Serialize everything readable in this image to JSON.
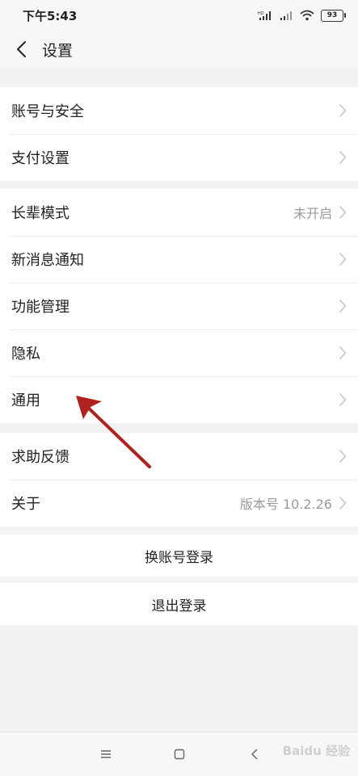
{
  "status_bar": {
    "time": "下午5:43",
    "battery": "93"
  },
  "header": {
    "title": "设置"
  },
  "groups": [
    {
      "items": [
        {
          "label": "账号与安全",
          "value": ""
        },
        {
          "label": "支付设置",
          "value": ""
        }
      ]
    },
    {
      "items": [
        {
          "label": "长辈模式",
          "value": "未开启"
        },
        {
          "label": "新消息通知",
          "value": ""
        },
        {
          "label": "功能管理",
          "value": ""
        },
        {
          "label": "隐私",
          "value": ""
        },
        {
          "label": "通用",
          "value": ""
        }
      ]
    },
    {
      "items": [
        {
          "label": "求助反馈",
          "value": ""
        },
        {
          "label": "关于",
          "value": "版本号 10.2.26"
        }
      ]
    }
  ],
  "actions": {
    "switch_account": "换账号登录",
    "logout": "退出登录"
  },
  "watermark": "Baidu 经验",
  "colors": {
    "annotation_arrow": "#b0201c",
    "background": "#f2f2f2"
  }
}
